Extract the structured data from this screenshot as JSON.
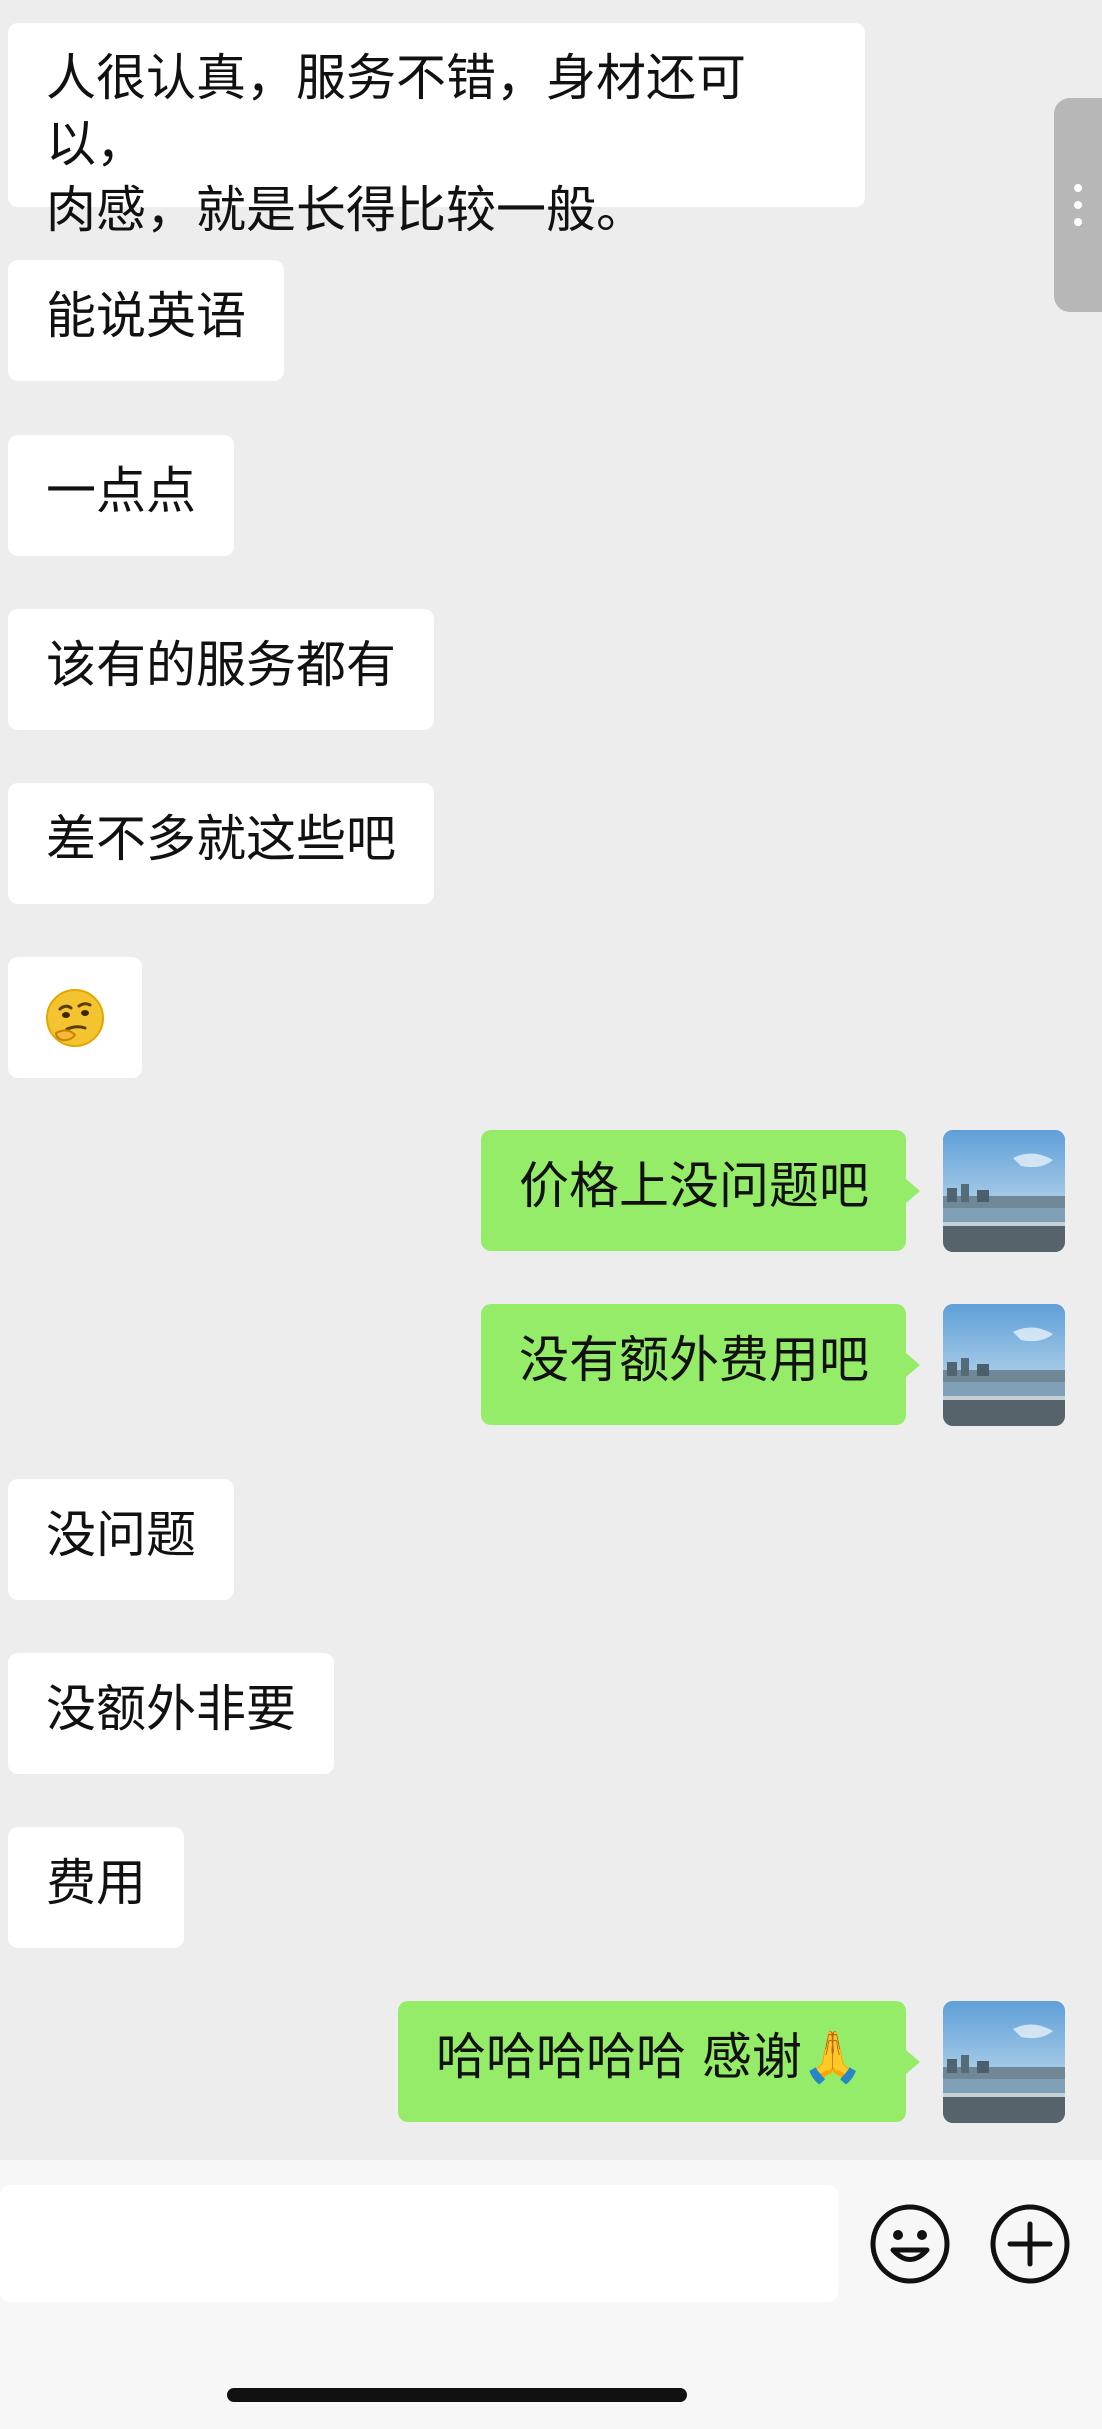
{
  "messages": {
    "m1": {
      "line1": "人很认真，服务不错，身材还可以，",
      "line2": "肉感，就是长得比较一般。"
    },
    "m2": "能说英语",
    "m3": "一点点",
    "m4": "该有的服务都有",
    "m5": "差不多就这些吧",
    "m6_emoji": "🤔",
    "m7": "价格上没问题吧",
    "m8": "没有额外费用吧",
    "m9": "没问题",
    "m10": "没额外非要",
    "m11": "费用",
    "m12": "哈哈哈哈哈 感谢🙏"
  },
  "icons": {
    "emoji_button": "smiley-face-icon",
    "plus_button": "plus-circle-icon",
    "more_tab": "three-dots-icon"
  },
  "colors": {
    "background": "#ededed",
    "incoming_bubble": "#ffffff",
    "outgoing_bubble": "#95ec69",
    "bottom_bar": "#f7f7f7"
  }
}
